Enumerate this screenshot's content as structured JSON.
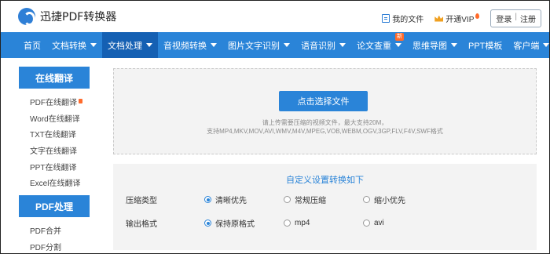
{
  "header": {
    "logo_text": "迅捷PDF转换器",
    "my_files": "我的文件",
    "vip": "开通VIP",
    "login": "登录",
    "divider": "|",
    "register": "注册"
  },
  "nav": {
    "items": [
      {
        "label": "首页"
      },
      {
        "label": "文档转换"
      },
      {
        "label": "文档处理"
      },
      {
        "label": "音视频转换"
      },
      {
        "label": "图片文字识别"
      },
      {
        "label": "语音识别"
      },
      {
        "label": "论文查重",
        "badge": "新"
      },
      {
        "label": "思维导图"
      },
      {
        "label": "PPT模板"
      },
      {
        "label": "客户端"
      }
    ]
  },
  "sidebar": {
    "translate_title": "在线翻译",
    "translate_items": [
      "PDF在线翻译",
      "Word在线翻译",
      "TXT在线翻译",
      "文字在线翻译",
      "PPT在线翻译",
      "Excel在线翻译"
    ],
    "pdf_title": "PDF处理",
    "pdf_items": [
      "PDF合并",
      "PDF分割"
    ]
  },
  "upload": {
    "button": "点击选择文件",
    "hint1": "请上传需要压缩的视频文件，最大支持20M，",
    "hint2": "支持MP4,MKV,MOV,AVI,WMV,M4V,MPEG,VOB,WEBM,OGV,3GP,FLV,F4V,SWF格式"
  },
  "settings": {
    "title": "自定义设置转换如下",
    "compress_label": "压缩类型",
    "compress_options": [
      "清晰优先",
      "常规压缩",
      "缩小优先"
    ],
    "compress_selected": "清晰优先",
    "format_label": "输出格式",
    "format_options": [
      "保持原格式",
      "mp4",
      "avi"
    ],
    "format_selected": "保持原格式"
  },
  "colors": {
    "accent": "#2a84d8",
    "nav_active": "#1560b3",
    "badge": "#ff6b2c"
  }
}
